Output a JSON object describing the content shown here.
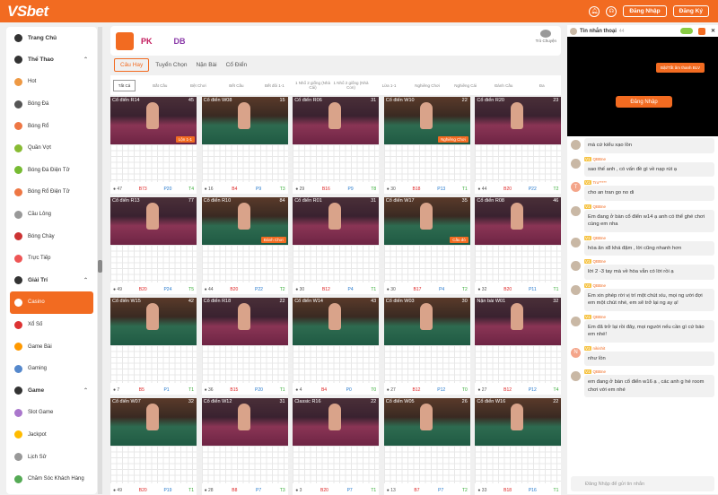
{
  "header": {
    "logo": "VSbet",
    "login": "Đăng Nhập",
    "register": "Đăng Ký"
  },
  "sidebar": {
    "items": [
      {
        "label": "Trang Chủ",
        "type": "head",
        "icon": "home-icon"
      },
      {
        "label": "Thể Thao",
        "type": "head",
        "icon": "sports-icon",
        "chev": "⌃"
      },
      {
        "label": "Hot",
        "icon": "hot-icon"
      },
      {
        "label": "Bóng Đá",
        "icon": "soccer-icon"
      },
      {
        "label": "Bóng Rổ",
        "icon": "basketball-icon"
      },
      {
        "label": "Quần Vợt",
        "icon": "tennis-icon"
      },
      {
        "label": "Bóng Đá Điện Tử",
        "icon": "esoccer-icon"
      },
      {
        "label": "Bóng Rổ Điện Tử",
        "icon": "ebasketball-icon"
      },
      {
        "label": "Cầu Lông",
        "icon": "badminton-icon"
      },
      {
        "label": "Bóng Chày",
        "icon": "baseball-icon"
      },
      {
        "label": "Trực Tiếp",
        "icon": "live-icon"
      },
      {
        "label": "Giải Trí",
        "type": "head",
        "icon": "entertainment-icon",
        "chev": "⌃"
      },
      {
        "label": "Casino",
        "type": "active",
        "icon": "casino-icon"
      },
      {
        "label": "Xổ Số",
        "icon": "lottery-icon"
      },
      {
        "label": "Game Bài",
        "icon": "cards-icon"
      },
      {
        "label": "Gaming",
        "icon": "gaming-icon"
      },
      {
        "label": "Game",
        "type": "head",
        "icon": "game-icon",
        "chev": "⌃"
      },
      {
        "label": "Slot Game",
        "icon": "slot-icon"
      },
      {
        "label": "Jackpot",
        "icon": "jackpot-icon"
      },
      {
        "label": "Lịch Sử",
        "icon": "history-icon"
      },
      {
        "label": "Chăm Sóc Khách Hàng",
        "icon": "support-icon"
      }
    ]
  },
  "providers": [
    "",
    "PK",
    "",
    "",
    "DB"
  ],
  "providers_chat": "Trò Chuyện",
  "tabs": [
    "Câu Hay",
    "Tuyển Chọn",
    "Nặn Bài",
    "Cổ Điển"
  ],
  "filters": [
    "Tất Cả",
    "Bắt Cầu",
    "Bệt Chơi",
    "Bết Cầu",
    "Bết đôi 1-1",
    "1 Nhổ 2 giống (Nhà Cái)",
    "1 Nhổ 2 giống (Nhà Con)",
    "Lừa 1-1",
    "Nghiêng Chơi",
    "Nghiêng Cái",
    "Đánh Cầu",
    "Đa"
  ],
  "tables": [
    {
      "name": "Cổ điển R14",
      "count": "45",
      "tag": "Lộn 1-1",
      "pink": true,
      "stats": [
        "47",
        "73",
        "20",
        "4"
      ]
    },
    {
      "name": "Cổ điển W08",
      "count": "15",
      "tag": "",
      "pink": false,
      "stats": [
        "16",
        "4",
        "9",
        "3"
      ]
    },
    {
      "name": "Cổ điển R06",
      "count": "31",
      "tag": "",
      "pink": true,
      "stats": [
        "29",
        "16",
        "9",
        "8"
      ]
    },
    {
      "name": "Cổ điển W10",
      "count": "22",
      "tag": "Nghiêng Chơi",
      "pink": false,
      "stats": [
        "30",
        "18",
        "13",
        "1"
      ]
    },
    {
      "name": "Cổ điển R20",
      "count": "23",
      "tag": "",
      "pink": true,
      "stats": [
        "44",
        "20",
        "22",
        "2"
      ]
    },
    {
      "name": "Cổ điển R13",
      "count": "77",
      "tag": "",
      "pink": true,
      "stats": [
        "49",
        "20",
        "24",
        "5"
      ]
    },
    {
      "name": "Cổ điển R10",
      "count": "84",
      "tag": "Đánh Chơi",
      "pink": false,
      "stats": [
        "44",
        "20",
        "22",
        "2"
      ]
    },
    {
      "name": "Cổ điển R01",
      "count": "31",
      "tag": "",
      "pink": true,
      "stats": [
        "30",
        "12",
        "4",
        "1"
      ]
    },
    {
      "name": "Cổ điển W17",
      "count": "35",
      "tag": "Cầu đỏ",
      "pink": false,
      "stats": [
        "30",
        "17",
        "4",
        "2"
      ]
    },
    {
      "name": "Cổ điển R08",
      "count": "46",
      "tag": "",
      "pink": true,
      "stats": [
        "32",
        "20",
        "11",
        "1"
      ]
    },
    {
      "name": "Cổ điển W15",
      "count": "42",
      "tag": "",
      "pink": false,
      "stats": [
        "7",
        "5",
        "1",
        "1"
      ]
    },
    {
      "name": "Cổ điển R18",
      "count": "22",
      "tag": "",
      "pink": true,
      "stats": [
        "36",
        "15",
        "20",
        "1"
      ]
    },
    {
      "name": "Cổ điển W14",
      "count": "43",
      "tag": "",
      "pink": false,
      "stats": [
        "4",
        "4",
        "0",
        "0"
      ]
    },
    {
      "name": "Cổ điển W03",
      "count": "30",
      "tag": "",
      "pink": false,
      "stats": [
        "27",
        "12",
        "12",
        "0"
      ]
    },
    {
      "name": "Nặn bài W01",
      "count": "32",
      "tag": "",
      "pink": true,
      "stats": [
        "27",
        "12",
        "12",
        "4"
      ]
    },
    {
      "name": "Cổ điển W07",
      "count": "32",
      "tag": "",
      "pink": false,
      "stats": [
        "49",
        "20",
        "19",
        "1"
      ]
    },
    {
      "name": "Cổ điển W12",
      "count": "31",
      "tag": "",
      "pink": true,
      "stats": [
        "28",
        "8",
        "7",
        "3"
      ]
    },
    {
      "name": "Classic R16",
      "count": "22",
      "tag": "",
      "pink": true,
      "stats": [
        "3",
        "20",
        "7",
        "1"
      ]
    },
    {
      "name": "Cổ điển W05",
      "count": "26",
      "tag": "",
      "pink": false,
      "stats": [
        "13",
        "7",
        "7",
        "2"
      ]
    },
    {
      "name": "Cổ điển W16",
      "count": "22",
      "tag": "",
      "pink": false,
      "stats": [
        "33",
        "18",
        "16",
        "1"
      ]
    }
  ],
  "chat": {
    "title": "Tin nhắn thoại",
    "count": "44",
    "tip": "Bật/Tắt âm thanh BLV",
    "login": "Đăng Nhập",
    "messages": [
      {
        "user": "",
        "text": "mà cứ kiểu xạo lồn"
      },
      {
        "user": "QBBne",
        "text": "sao thế anh , có vấn đề gì về nạp rút ạ"
      },
      {
        "user": "Tru*****",
        "avatar": "T",
        "text": "cho an tran go no di"
      },
      {
        "user": "QBBne",
        "text": "Em đang ở bàn cổ điển w14 ạ anh có thể ghé chơi cùng em nha"
      },
      {
        "user": "QBBne",
        "text": "hòa ăn x8 khá đậm , lời cũng nhanh hơn"
      },
      {
        "user": "QBBne",
        "text": "lời 2 -3 tay mà về hòa vẫn có lời rồi ạ"
      },
      {
        "user": "QBBne",
        "text": "Em xin phép rời vị trí một chút xíu, mọi ng ười đợi em một chút nhé, em sẽ trở lại ng ay ạ!"
      },
      {
        "user": "QBBne",
        "text": "Em đã trở lại rồi đây, mọi người nếu cần gì cứ báo em nhé!"
      },
      {
        "user": "nikishit",
        "avatar": "N",
        "text": "như lồn"
      },
      {
        "user": "QBBne",
        "text": "em đang ở bàn cổ điển w16 ạ , các anh g hé room chơi với em nhé"
      }
    ],
    "input_placeholder": "Đăng Nhập để gửi tin nhắn"
  }
}
